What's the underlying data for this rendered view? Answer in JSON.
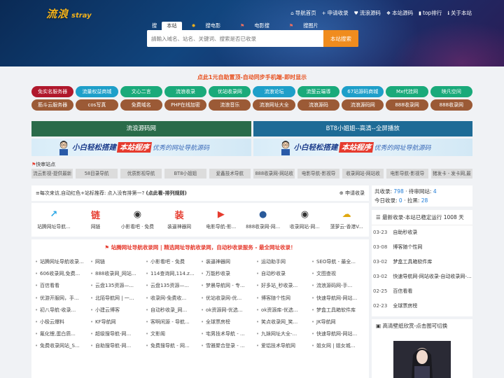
{
  "header": {
    "logo_cn": "流浪",
    "logo_en": "stray",
    "nav": [
      {
        "icon": "home-icon",
        "glyph": "⌂",
        "label": "导航首页"
      },
      {
        "icon": "plus-icon",
        "glyph": "+",
        "label": "申请收录"
      },
      {
        "icon": "heart-icon",
        "glyph": "♥",
        "label": "流浪源码"
      },
      {
        "icon": "code-icon",
        "glyph": "❖",
        "label": "本站源码"
      },
      {
        "icon": "bar-chart-icon",
        "glyph": "▮",
        "label": "top排行"
      },
      {
        "icon": "info-icon",
        "glyph": "ℹ",
        "label": "关于本站"
      }
    ]
  },
  "search": {
    "tabs": [
      "搜",
      "本站",
      "搜电影",
      "电影搜",
      "搜图片"
    ],
    "placeholder": "請輸入域名、站名、关键词、搜索是否已收录",
    "button": "本站搜索"
  },
  "promo": "点此1元自助置顶-自动同步手机端-即时显示",
  "grid": [
    {
      "label": "免实名服务器",
      "color": "#b0182c"
    },
    {
      "label": "流量权益商城",
      "color": "#1e9fc9"
    },
    {
      "label": "文心二言",
      "color": "#1aaa7a"
    },
    {
      "label": "流浪收录",
      "color": "#1aaa7a"
    },
    {
      "label": "优站收录网",
      "color": "#1aaa7a"
    },
    {
      "label": "流浪论坛",
      "color": "#1e9fc9"
    },
    {
      "label": "流萤云端導",
      "color": "#1aaa7a"
    },
    {
      "label": "67站源码商城",
      "color": "#1e9fc9"
    },
    {
      "label": "Mx代挂网",
      "color": "#1aaa7a"
    },
    {
      "label": "映凡空间",
      "color": "#1aaa7a"
    },
    {
      "label": "筋斗云服务器",
      "color": "#9b5a36"
    },
    {
      "label": "cos写真",
      "color": "#9b5a36"
    },
    {
      "label": "免费域名",
      "color": "#9b5a36"
    },
    {
      "label": "PHP在线加密",
      "color": "#9b5a36"
    },
    {
      "label": "流浪音乐",
      "color": "#9b5a36"
    },
    {
      "label": "流浪网址大全",
      "color": "#9b5a36"
    },
    {
      "label": "流浪源码",
      "color": "#9b5a36"
    },
    {
      "label": "流浪源码网",
      "color": "#9b5a36"
    },
    {
      "label": "888收录网",
      "color": "#9b5a36"
    },
    {
      "label": "888收录网",
      "color": "#9b5a36"
    }
  ],
  "banners": [
    {
      "title": "流浪源码网",
      "color": "#2a6b4a",
      "t1": "小白轻松搭建",
      "t2": "本站程序",
      "t3": "优秀的网址导航源码"
    },
    {
      "title": "BT8小姐姐--高清--全屏播放",
      "color": "#1e6b96",
      "t1": "小白轻松搭建",
      "t2": "本站程序",
      "t3": "优秀的网址导航源码"
    }
  ],
  "quick": {
    "title": "快审站点",
    "items": [
      "流云影视-提供最新",
      "58目录导航",
      "优质影视导航",
      "BT8小姐姐",
      "爱鑫技术导航",
      "888收录网-网站收",
      "电影导航-影视导",
      "收录网站-网站收",
      "电影导航-影视导",
      "猪发卡 - 发卡网,最"
    ]
  },
  "notice": {
    "text": "≡每次来访,自动红色+站标推荐: 点入没有排第一? ",
    "bold": "(点此看-排列规则)",
    "apply": "申请收录"
  },
  "stats": {
    "line1_a": "共收录:",
    "line1_a_val": "798",
    "line1_b": "待审网站:",
    "line1_b_val": "4",
    "line2_a": "今日收录:",
    "line2_a_val": "0",
    "line2_b": "拉黑:",
    "line2_b_val": "28"
  },
  "icons": [
    {
      "name": "link-icon",
      "glyph": "↗",
      "color": "#2aa7e6",
      "label": "站腾网址导航..."
    },
    {
      "name": "chain-icon",
      "glyph": "链",
      "color": "#e63b2e",
      "label": "网链"
    },
    {
      "name": "globe-icon",
      "glyph": "◉",
      "color": "#333",
      "label": "小影看吧 · 免费"
    },
    {
      "name": "tool-icon",
      "glyph": "装",
      "color": "#e63b2e",
      "label": "装逼神器网"
    },
    {
      "name": "play-icon",
      "glyph": "▶",
      "color": "#e63b2e",
      "label": "电影导航-影..."
    },
    {
      "name": "planet-icon",
      "glyph": "●",
      "color": "#2a5a9a",
      "label": "888收录网-网..."
    },
    {
      "name": "globe-icon",
      "glyph": "◉",
      "color": "#333",
      "label": "收录网站-网..."
    },
    {
      "name": "cloud-icon",
      "glyph": "☁",
      "color": "#e0a810",
      "label": "菠萝云-香港V..."
    }
  ],
  "links": {
    "title": "站腾网址导航收录网 | 精选网址导航收录网，自动秒收录服务 - 最全网址收录！",
    "items": [
      "站腾网址导航收录...",
      "网链",
      "小影看吧 - 免费",
      "装逼神器网",
      "运动助手网",
      "SEO导航 - 最全...",
      "606收录网,免费...",
      "888收录网_网站...",
      "114查询网,114.z...",
      "万能秒收录",
      "自动秒收录",
      "文图查视",
      "百信看看",
      "云盘135资源—...",
      "云盘135资源—...",
      "梦晨导航网 - 专...",
      "好多站_秒收录...",
      "流浪源码网-手...",
      "优游开服网，手...",
      "北陌导航网 | 一...",
      "收录网-免费收...",
      "优站收录网-优...",
      "博客随个性网",
      "快速导航网-网站...",
      "初八导航-收录...",
      "小建云博客",
      "自动秒收录_网...",
      "ok资源网-优选...",
      "ok资源库-优选...",
      "梦盒工具箱软件库",
      "小极云爆料",
      "KF导航网",
      "客啊闲源 - 导航...",
      "全球票房榜",
      "笑点收录网_笑...",
      "JK导航网",
      "氟化锂,蛋白质...",
      "超级搜导航-网...",
      "文影阁",
      "宅男技术导航 - ...",
      "九妹网址大全-...",
      "快速导航网-网站...",
      "免费收录网站_S...",
      "自助搜导航-网...",
      "免费搜导航 - 网...",
      "雪雅聚合登录 - ...",
      "爱铝技术导航网",
      "姐女网 | 姐女城..."
    ]
  },
  "side1": {
    "title": "最新收录-本站已稳定运行 1008 天",
    "items": [
      {
        "date": "03-23",
        "text": "自助秒收录"
      },
      {
        "date": "03-08",
        "text": "博客随个性网"
      },
      {
        "date": "03-02",
        "text": "梦盒工具箱软件库"
      },
      {
        "date": "03-02",
        "text": "快速导航网-网站收录-自动收录网-..."
      },
      {
        "date": "02-25",
        "text": "百信看看"
      },
      {
        "date": "02-23",
        "text": "全球票房榜"
      }
    ]
  },
  "side2": {
    "title": "高清壁纸欣赏-点击图可切换"
  }
}
